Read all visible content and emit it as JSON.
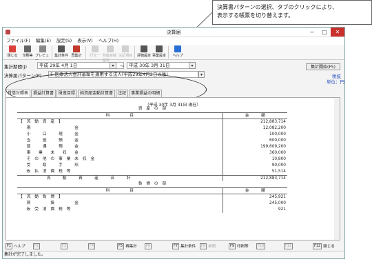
{
  "callout": {
    "line1": "決算書パターンの選択、タブのクリックにより、",
    "line2": "表示する帳票を切り替えます。"
  },
  "window": {
    "title": "決算届",
    "min": "−",
    "max": "□",
    "close": "✕"
  },
  "menu": [
    "ファイル(F)",
    "編集(E)",
    "設定(S)",
    "表示(V)",
    "ヘルプ(H)"
  ],
  "toolbar": [
    {
      "label": "閉じる",
      "icon": "close-icon",
      "color": "#d9413a",
      "enabled": true
    },
    {
      "label": "印刷等",
      "icon": "printer-icon",
      "color": "#666666",
      "enabled": true
    },
    {
      "label": "プレビュー",
      "icon": "preview-icon",
      "color": "#888888",
      "enabled": true
    },
    {
      "label": "集計条件",
      "icon": "filter-icon",
      "color": "#555555",
      "enabled": true
    },
    {
      "label": "再集計",
      "icon": "recalc-icon",
      "color": "#c0392b",
      "enabled": true
    },
    {
      "label": "行元一",
      "icon": "line-icon",
      "color": "#888888",
      "enabled": false
    },
    {
      "label": "財産目録設定",
      "icon": "list-icon",
      "color": "#888888",
      "enabled": false
    },
    {
      "label": "注記項目",
      "icon": "note-icon",
      "color": "#888888",
      "enabled": false
    },
    {
      "label": "評価設定",
      "icon": "eval-icon",
      "color": "#555555",
      "enabled": true
    },
    {
      "label": "事業設定",
      "icon": "business-icon",
      "color": "#555555",
      "enabled": true
    },
    {
      "label": "ヘルプ",
      "icon": "help-icon",
      "color": "#2a6fd6",
      "enabled": true
    }
  ],
  "filter": {
    "period_label": "集計期間(J)",
    "from_era": "平成",
    "from_year": "29",
    "from_y_label": "年",
    "from_month": "4",
    "from_m_label": "月",
    "from_day": "1",
    "from_d_label": "日",
    "tilde": "〜",
    "to_era": "平成",
    "to_year": "30",
    "to_y_label": "年",
    "to_month": "3",
    "to_m_label": "月",
    "to_day": "31",
    "to_d_label": "日",
    "pattern_label": "決算届パターン(P)",
    "pattern_value": "5:医療法人会計基準を適用する法人(平成29年4月2日以後)",
    "start_button": "集計開始(F5)",
    "tax_mode": "税抜",
    "unit": "単位：円"
  },
  "tabs": [
    "貸借対照表",
    "損益計算書",
    "財産目録",
    "純資産変動計算書",
    "注記",
    "事業損益の明細"
  ],
  "report": {
    "period": "（平成 30年  3月 31日 現在）",
    "asset_section": "資　産　の　部",
    "col_item": "科　　　　　目",
    "col_amount": "金　　　額",
    "asset_rows": [
      {
        "name": "【　流　動　資　産　】",
        "amount": "212,883,714"
      },
      {
        "name": "　　現　　　　　　　　　　　金",
        "amount": "12,082,200"
      },
      {
        "name": "　　小　　　口　　　現　　　金",
        "amount": "100,000"
      },
      {
        "name": "　　当　　　座　　　預　　　金",
        "amount": "600,000"
      },
      {
        "name": "　　普　　　通　　　預　　　金",
        "amount": "199,609,200"
      },
      {
        "name": "　　事　　業　　未　　収　　金",
        "amount": "360,000"
      },
      {
        "name": "　　そ　の　他　の　事　業　未　収　金",
        "amount": "10,800"
      },
      {
        "name": "　　受　　　取　　　手　　　形",
        "amount": "90,000"
      },
      {
        "name": "　　仮　払　消　費　税　等",
        "amount": "51,514"
      },
      {
        "name": "　　　　　　　流　　　動　　　資　　　産　　　合　　　計",
        "amount": "212,883,714"
      }
    ],
    "liab_section": "負　債　の　部",
    "liab_rows": [
      {
        "name": "【　流　動　負　債　】",
        "amount": "245,921"
      },
      {
        "name": "　　買　　　　　掛　　　　　金",
        "amount": "245,000"
      },
      {
        "name": "　　仮　受　消　費　税　等",
        "amount": "921"
      }
    ]
  },
  "fkeys": [
    {
      "key": "F1",
      "label": "ヘルプ",
      "enabled": true
    },
    {
      "key": "F2",
      "label": "",
      "enabled": false
    },
    {
      "key": "F3",
      "label": "",
      "enabled": false
    },
    {
      "key": "F4",
      "label": "",
      "enabled": false
    },
    {
      "key": "F5",
      "label": "再集計",
      "enabled": true
    },
    {
      "key": "F6",
      "label": "",
      "enabled": false
    },
    {
      "key": "F7",
      "label": "集計条件",
      "enabled": true
    },
    {
      "key": "F8",
      "label": "参照",
      "enabled": false
    },
    {
      "key": "F9",
      "label": "印刷等",
      "enabled": true
    },
    {
      "key": "F10",
      "label": "",
      "enabled": false
    },
    {
      "key": "F11",
      "label": "",
      "enabled": false
    },
    {
      "key": "F12",
      "label": "閉じる",
      "enabled": true
    }
  ],
  "status": "集計が完了しました。"
}
